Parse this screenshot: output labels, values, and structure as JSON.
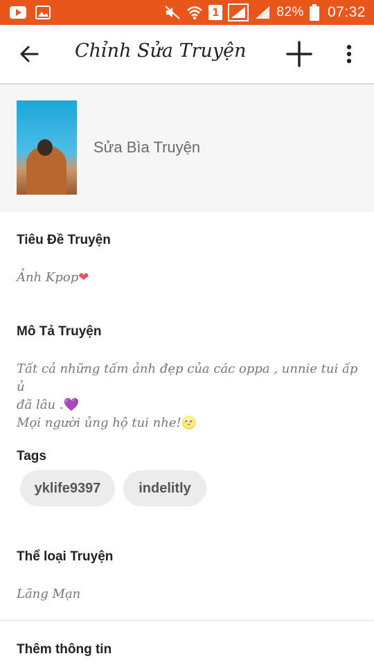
{
  "status_bar": {
    "battery_percent": "82%",
    "time": "07:32",
    "sim_slot": "1"
  },
  "app_bar": {
    "title": "Chỉnh Sửa Truyện"
  },
  "cover": {
    "label": "Sửa Bìa Truyện"
  },
  "story": {
    "title_label": "Tiêu Đề Truyện",
    "title_value": "Ảnh Kpop",
    "title_emoji": "❤",
    "description_label": "Mô Tả Truyện",
    "description_line1": "Tất cả những tấm ảnh đẹp của các oppa , unnie tui ấp ủ",
    "description_line2": "đã lâu .",
    "description_emoji1": "💜",
    "description_line3": "Mọi người ủng hộ tui nhe!",
    "description_emoji2": "🌝",
    "tags_label": "Tags",
    "tags": [
      "yklife9397",
      "indelitly"
    ],
    "category_label": "Thể loại Truyện",
    "category_value": "Lãng Mạn",
    "more_info_label": "Thêm thông tin"
  },
  "colors": {
    "status_bar": "#e8561b",
    "cover_bg": "#f6f6f6",
    "tag_bg": "#ececec"
  }
}
